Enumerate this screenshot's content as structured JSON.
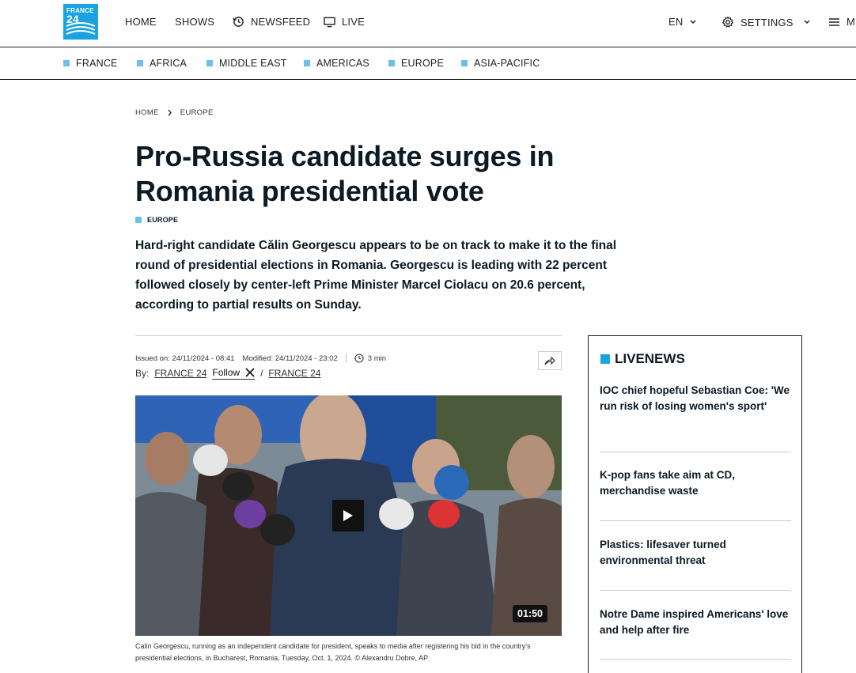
{
  "header": {
    "logo_line1": "FRANCE",
    "logo_line2": "24",
    "nav": {
      "home": "HOME",
      "shows": "SHOWS",
      "newsfeed": "NEWSFEED",
      "live": "LIVE",
      "language": "EN",
      "settings": "SETTINGS",
      "menu": "M"
    }
  },
  "subnav": [
    "FRANCE",
    "AFRICA",
    "MIDDLE EAST",
    "AMERICAS",
    "EUROPE",
    "ASIA-PACIFIC"
  ],
  "breadcrumb": {
    "home": "HOME",
    "section": "EUROPE"
  },
  "article": {
    "title": "Pro-Russia candidate surges in Romania presidential vote",
    "tag": "EUROPE",
    "lead": "Hard-right candidate Călin Georgescu appears to be on track to make it to the final round of presidential elections in Romania. Georgescu is leading with 22 percent followed closely by center-left Prime Minister Marcel Ciolacu on 20.6 percent, according to partial results on Sunday.",
    "issued": "Issued on: 24/11/2024 - 08:41",
    "modified": "Modified: 24/11/2024 - 23:02",
    "read_time": "3 min",
    "by_label": "By:",
    "author": "FRANCE 24",
    "follow_label": "Follow",
    "slash": "/",
    "author2": "FRANCE 24",
    "video_duration": "01:50",
    "caption": "Calin Georgescu, running as an independent candidate for president, speaks to media after registering his bid in the country's presidential elections, in Bucharest, Romania, Tuesday, Oct. 1, 2024.  © Alexandru Dobre, AP"
  },
  "livenews": {
    "heading": "LIVENEWS",
    "items": [
      "IOC chief hopeful Sebastian Coe: 'We run risk of losing women's sport'",
      "K-pop fans take aim at CD, merchandise waste",
      "Plastics: lifesaver turned environmental threat",
      "Notre Dame inspired Americans' love and help after fire"
    ]
  },
  "colors": {
    "brand": "#1aa3e0",
    "accent_square": "#6cc1ea",
    "text": "#0b1a24"
  },
  "icons": [
    "newsfeed-icon",
    "live-tv-icon",
    "settings-gear-icon",
    "menu-icon",
    "clock-icon",
    "x-logo-icon",
    "share-icon",
    "play-icon"
  ]
}
